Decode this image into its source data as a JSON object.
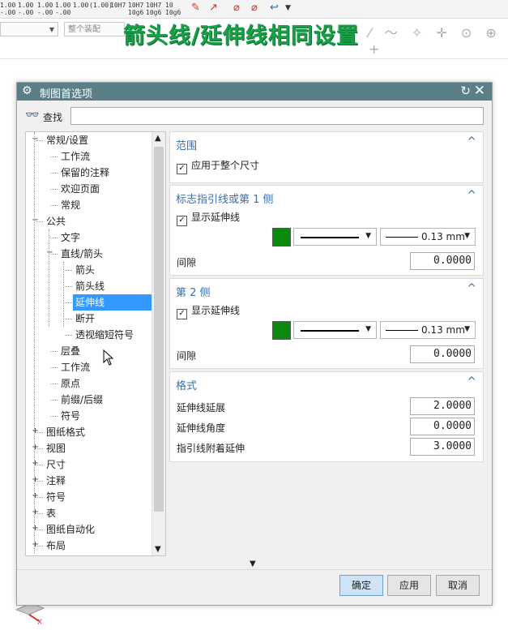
{
  "background": {
    "toolbar_items": [
      "1.00\n-.00",
      "1.00\n-.00",
      "1.00\n-.00",
      "1.00\n-.00",
      "1.00",
      "(1.00)",
      "10H7",
      "10H7\n10g6",
      "10H7\n10g6",
      "10\n10g6"
    ],
    "combo_left_text": "",
    "combo_right_text": "整个装配",
    "symbols": "⁄ 〜 ✧ ✛ ⊙ ⊕ +",
    "axis_label": "X"
  },
  "overlay_title": "箭头线/延伸线相同设置",
  "dialog": {
    "title": "制图首选项",
    "find_label": "查找",
    "find_value": "",
    "tree": [
      {
        "label": "常规/设置",
        "level": 0,
        "expander": "−"
      },
      {
        "label": "工作流",
        "level": 1
      },
      {
        "label": "保留的注释",
        "level": 1
      },
      {
        "label": "欢迎页面",
        "level": 1
      },
      {
        "label": "常规",
        "level": 1
      },
      {
        "label": "公共",
        "level": 0,
        "expander": "−"
      },
      {
        "label": "文字",
        "level": 1
      },
      {
        "label": "直线/箭头",
        "level": 1,
        "expander": "−"
      },
      {
        "label": "箭头",
        "level": 2
      },
      {
        "label": "箭头线",
        "level": 2
      },
      {
        "label": "延伸线",
        "level": 2,
        "selected": true
      },
      {
        "label": "断开",
        "level": 2
      },
      {
        "label": "透视缩短符号",
        "level": 2
      },
      {
        "label": "层叠",
        "level": 1
      },
      {
        "label": "工作流",
        "level": 1
      },
      {
        "label": "原点",
        "level": 1
      },
      {
        "label": "前缀/后缀",
        "level": 1
      },
      {
        "label": "符号",
        "level": 1
      },
      {
        "label": "图纸格式",
        "level": 0,
        "expander": "+"
      },
      {
        "label": "视图",
        "level": 0,
        "expander": "+"
      },
      {
        "label": "尺寸",
        "level": 0,
        "expander": "+"
      },
      {
        "label": "注释",
        "level": 0,
        "expander": "+"
      },
      {
        "label": "符号",
        "level": 0,
        "expander": "+"
      },
      {
        "label": "表",
        "level": 0,
        "expander": "+"
      },
      {
        "label": "图纸自动化",
        "level": 0,
        "expander": "+"
      },
      {
        "label": "布局",
        "level": 0,
        "expander": "+"
      }
    ],
    "panels": {
      "scope": {
        "title": "范围",
        "checkbox": "应用于整个尺寸"
      },
      "side1": {
        "title": "标志指引线或第 1 侧",
        "checkbox": "显示延伸线",
        "width": "0.13 mm",
        "gap_label": "间隙",
        "gap_value": "0.0000"
      },
      "side2": {
        "title": "第 2 侧",
        "checkbox": "显示延伸线",
        "width": "0.13 mm",
        "gap_label": "间隙",
        "gap_value": "0.0000"
      },
      "format": {
        "title": "格式",
        "rows": [
          {
            "label": "延伸线延展",
            "value": "2.0000"
          },
          {
            "label": "延伸线角度",
            "value": "0.0000"
          },
          {
            "label": "指引线附着延伸",
            "value": "3.0000"
          }
        ]
      }
    },
    "line_color": "#0b8a0b",
    "buttons": {
      "ok": "确定",
      "apply": "应用",
      "cancel": "取消"
    }
  }
}
